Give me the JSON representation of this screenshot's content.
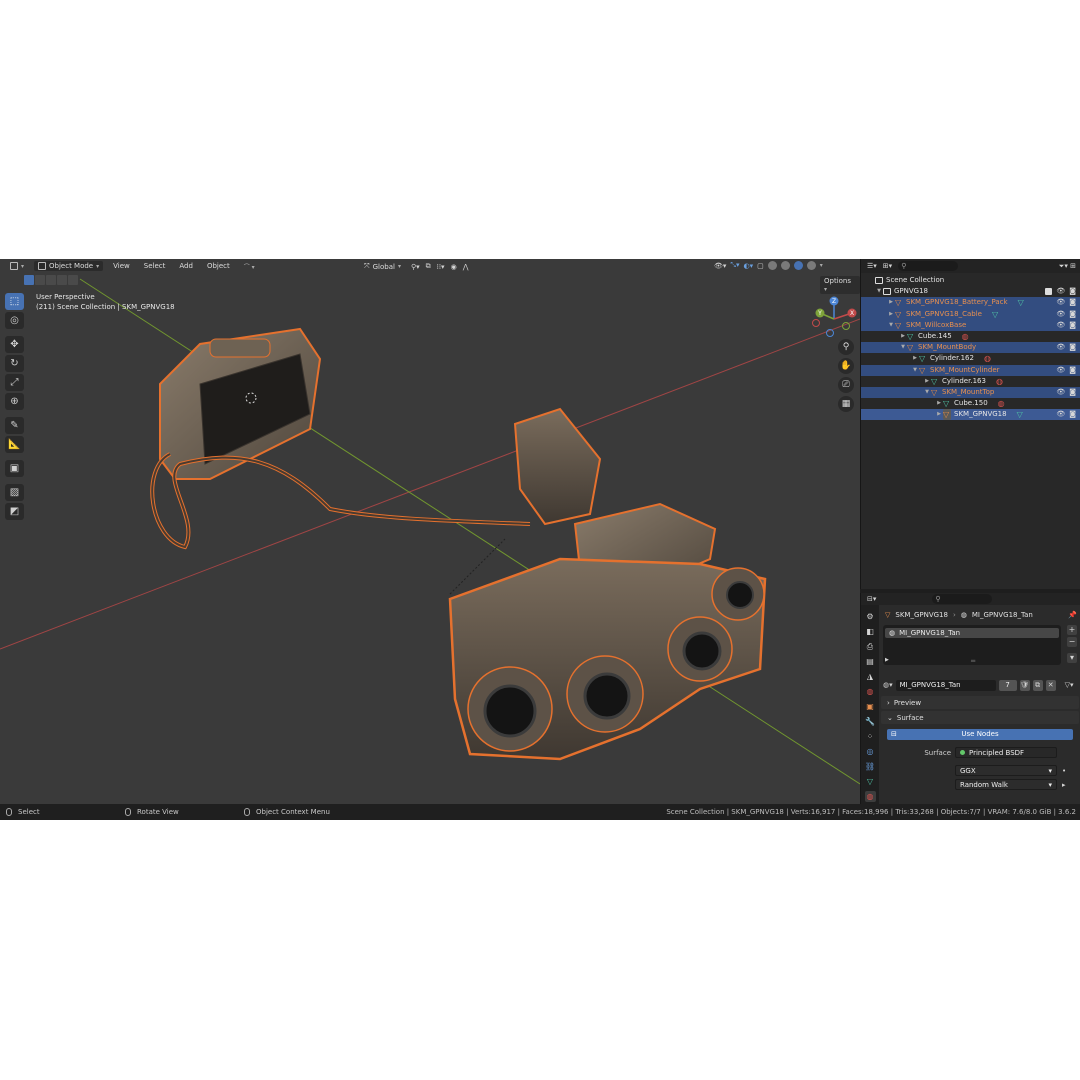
{
  "header": {
    "mode": "Object Mode",
    "menus": [
      "View",
      "Select",
      "Add",
      "Object"
    ],
    "transform_orientation": "Global",
    "options": "Options"
  },
  "viewport": {
    "perspective": "User Perspective",
    "context": "(211) Scene Collection | SKM_GPNVG18"
  },
  "outliner": {
    "header_icon": "outliner-icon",
    "search_placeholder": "",
    "rows": [
      {
        "label": "Scene Collection",
        "kind": "scene",
        "indent": 0
      },
      {
        "label": "GPNVG18",
        "kind": "collection",
        "indent": 1
      },
      {
        "label": "SKM_GPNVG18_Battery_Pack",
        "kind": "object",
        "indent": 2,
        "selected": true
      },
      {
        "label": "SKM_GPNVG18_Cable",
        "kind": "object",
        "indent": 2,
        "selected": true
      },
      {
        "label": "SKM_WillcoxBase",
        "kind": "object",
        "indent": 2,
        "selected": true
      },
      {
        "label": "Cube.145",
        "kind": "mesh",
        "indent": 3
      },
      {
        "label": "SKM_MountBody",
        "kind": "object",
        "indent": 3,
        "selected": true
      },
      {
        "label": "Cylinder.162",
        "kind": "mesh",
        "indent": 4
      },
      {
        "label": "SKM_MountCylinder",
        "kind": "object",
        "indent": 4,
        "selected": true
      },
      {
        "label": "Cylinder.163",
        "kind": "mesh",
        "indent": 5
      },
      {
        "label": "SKM_MountTop",
        "kind": "object",
        "indent": 5,
        "selected": true
      },
      {
        "label": "Cube.150",
        "kind": "mesh",
        "indent": 6
      },
      {
        "label": "SKM_GPNVG18",
        "kind": "object",
        "indent": 6,
        "selected": true,
        "active": true
      }
    ]
  },
  "properties": {
    "breadcrumb_object": "SKM_GPNVG18",
    "breadcrumb_material": "MI_GPNVG18_Tan",
    "slot_name": "MI_GPNVG18_Tan",
    "material_name": "MI_GPNVG18_Tan",
    "user_count": "7",
    "preview_label": "Preview",
    "surface_panel_label": "Surface",
    "use_nodes_label": "Use Nodes",
    "surface_label": "Surface",
    "surface_value": "Principled BSDF",
    "distribution": "GGX",
    "subsurface_method": "Random Walk"
  },
  "status": {
    "select": "Select",
    "rotate": "Rotate View",
    "context_menu": "Object Context Menu",
    "stats": "Scene Collection | SKM_GPNVG18 | Verts:16,917 | Faces:18,996 | Tris:33,268 | Objects:7/7 | VRAM: 7.6/8.0 GiB | 3.6.2"
  },
  "colors": {
    "accent": "#4772b3",
    "selection_outline": "#e5712e",
    "viewport_bg": "#3a3a3a",
    "x_axis": "#b34a4a",
    "y_axis": "#7ea33a"
  }
}
